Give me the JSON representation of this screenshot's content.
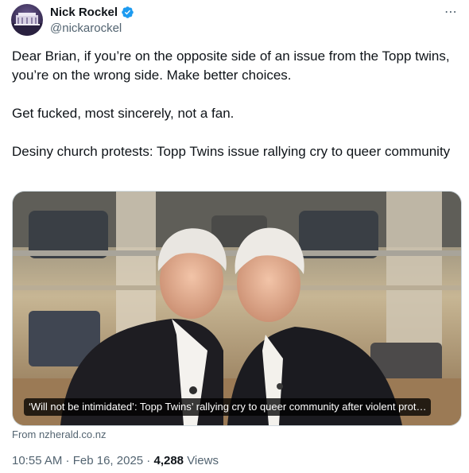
{
  "author": {
    "name": "Nick Rockel",
    "handle": "@nickarockel",
    "verified_icon": "verified-badge-icon",
    "badge_color": "#1d9bf0"
  },
  "more_icon": "⋯",
  "tweet": {
    "paragraphs": [
      "Dear Brian, if you’re on the opposite side of an issue from the Topp twins, you’re on the wrong side. Make better choices.",
      "Get fucked, most sincerely, not a fan.",
      "Desiny church protests: Topp Twins issue rallying cry to queer community"
    ]
  },
  "link_card": {
    "caption": "‘Will not be intimidated’: Topp Twins’ rallying cry to queer community after violent prot…",
    "source": "From nzherald.co.nz"
  },
  "meta": {
    "time": "10:55 AM",
    "separator": " · ",
    "date": "Feb 16, 2025",
    "views_count": "4,288",
    "views_label": " Views"
  }
}
